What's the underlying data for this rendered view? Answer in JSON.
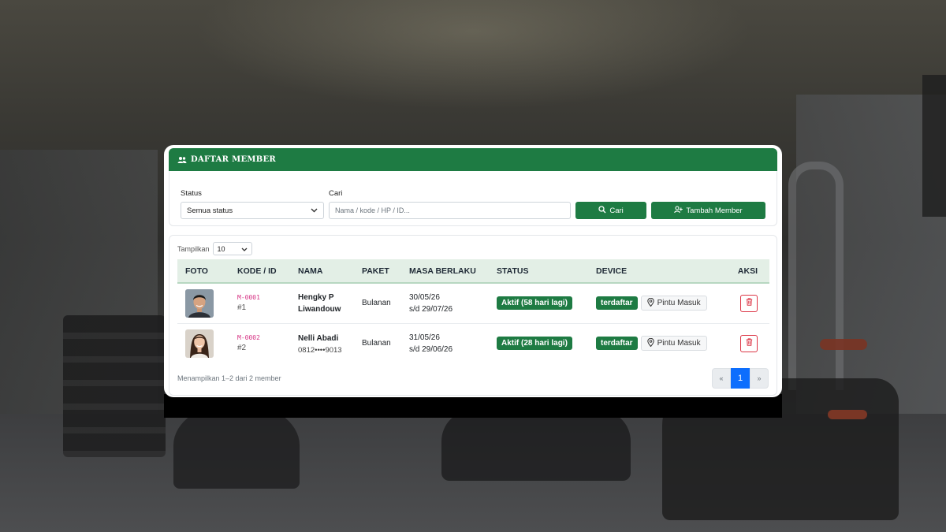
{
  "header": {
    "title": "DAFTAR MEMBER",
    "icon": "users-icon"
  },
  "filters": {
    "status_label": "Status",
    "status_value": "Semua status",
    "search_label": "Cari",
    "search_placeholder": "Nama / kode / HP / ID...",
    "search_button": "Cari",
    "add_button": "Tambah Member"
  },
  "table": {
    "show_label": "Tampilkan",
    "show_value": "10",
    "columns": [
      "FOTO",
      "KODE / ID",
      "NAMA",
      "PAKET",
      "MASA BERLAKU",
      "STATUS",
      "DEVICE",
      "AKSI"
    ],
    "rows": [
      {
        "kode": "M-0001",
        "id": "#1",
        "nama": "Hengky P Liwandouw",
        "sub": "",
        "paket": "Bulanan",
        "masa_start": "30/05/26",
        "masa_end": "s/d 29/07/26",
        "status": "Aktif (58 hari lagi)",
        "device_badge": "terdaftar",
        "device_button": "Pintu Masuk"
      },
      {
        "kode": "M-0002",
        "id": "#2",
        "nama": "Nelli Abadi",
        "sub": "0812••••9013",
        "paket": "Bulanan",
        "masa_start": "31/05/26",
        "masa_end": "s/d 29/06/26",
        "status": "Aktif (28 hari lagi)",
        "device_badge": "terdaftar",
        "device_button": "Pintu Masuk"
      }
    ]
  },
  "footer": {
    "summary": "Menampilkan 1–2 dari 2 member",
    "pagination": {
      "prev": "«",
      "current": "1",
      "next": "»"
    }
  },
  "colors": {
    "primary_green": "#1e7b43",
    "header_row_bg": "#e3efe6",
    "code_pink": "#d63384",
    "danger": "#dc3545",
    "page_active": "#0d6efd"
  }
}
